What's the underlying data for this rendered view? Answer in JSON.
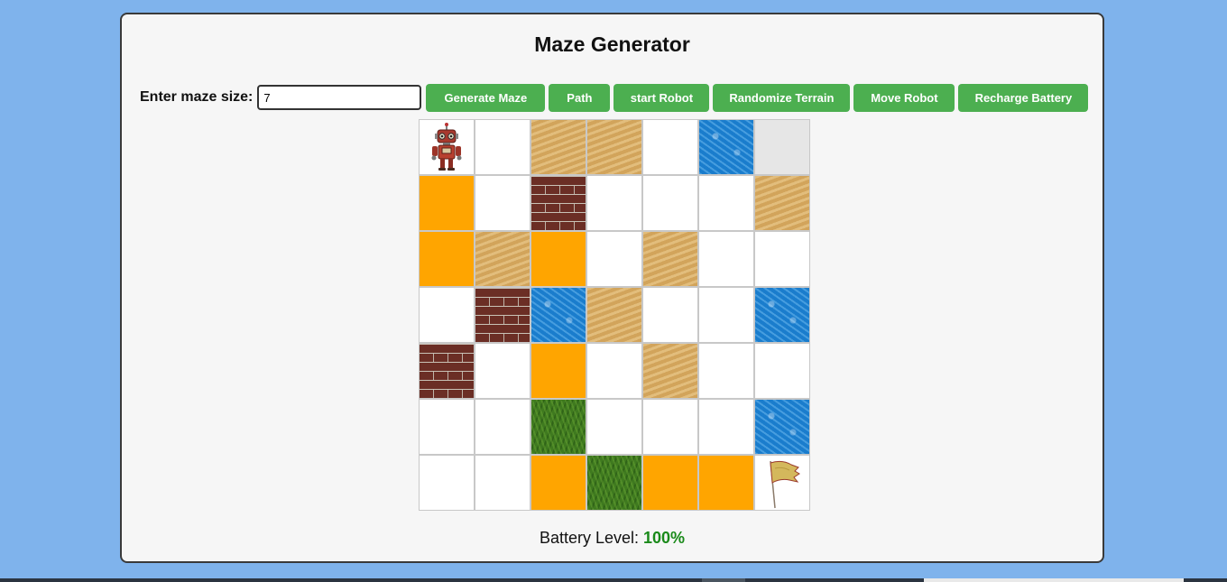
{
  "app": {
    "title": "Maze Generator"
  },
  "controls": {
    "size_label": "Enter maze size:",
    "size_value": "7",
    "buttons": {
      "generate": "Generate Maze",
      "path": "Path",
      "start_robot": "start Robot",
      "randomize": "Randomize Terrain",
      "move": "Move Robot",
      "recharge": "Recharge Battery"
    }
  },
  "maze": {
    "size": 7,
    "legend": {
      "empty": "open cell",
      "visited": "visited cell",
      "orange": "path cell",
      "sand": "sand terrain",
      "water": "water terrain",
      "brick": "brick wall",
      "grass": "grass terrain",
      "robot": "robot-icon",
      "flag": "goal-flag-icon"
    },
    "grid": [
      [
        "robot",
        "empty",
        "sand",
        "sand",
        "empty",
        "water",
        "visited"
      ],
      [
        "orange",
        "empty",
        "brick",
        "empty",
        "empty",
        "empty",
        "sand"
      ],
      [
        "orange",
        "sand",
        "orange",
        "empty",
        "sand",
        "empty",
        "empty"
      ],
      [
        "empty",
        "brick",
        "water",
        "sand",
        "empty",
        "empty",
        "water"
      ],
      [
        "brick",
        "empty",
        "orange",
        "empty",
        "sand",
        "empty",
        "empty"
      ],
      [
        "empty",
        "empty",
        "grass",
        "empty",
        "empty",
        "empty",
        "water"
      ],
      [
        "empty",
        "empty",
        "orange",
        "grass",
        "orange",
        "orange",
        "flag"
      ]
    ]
  },
  "battery": {
    "label": "Battery Level:",
    "value": "100%",
    "value_color": "#1a8a1a"
  },
  "colors": {
    "background": "#7fb3ec",
    "panel": "#f6f6f6",
    "button": "#4caf50",
    "path": "#ffa500"
  }
}
